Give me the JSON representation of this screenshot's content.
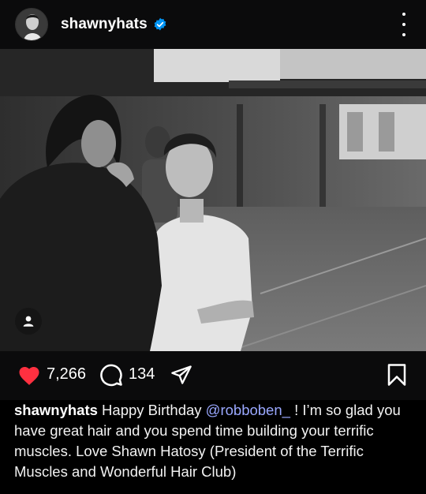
{
  "post": {
    "username": "shawnyhats",
    "verified": true
  },
  "engagement": {
    "likes": "7,266",
    "comments": "134"
  },
  "caption": {
    "username": "shawnyhats",
    "text_before": " Happy Birthday ",
    "mention": "@robboben_",
    "text_after": " ! I’m so glad you have great hair and you spend time building your terrific muscles.  Love Shawn Hatosy (President of the Terrific Muscles and Wonderful Hair Club)"
  },
  "colors": {
    "like": "#ff3040",
    "verified": "#0095f6",
    "mention": "#9aa8ff",
    "background": "#000000"
  },
  "icons": {
    "more": "more-options-icon",
    "like": "heart-icon",
    "comment": "comment-icon",
    "share": "send-icon",
    "save": "bookmark-icon",
    "tag": "person-tag-icon"
  }
}
